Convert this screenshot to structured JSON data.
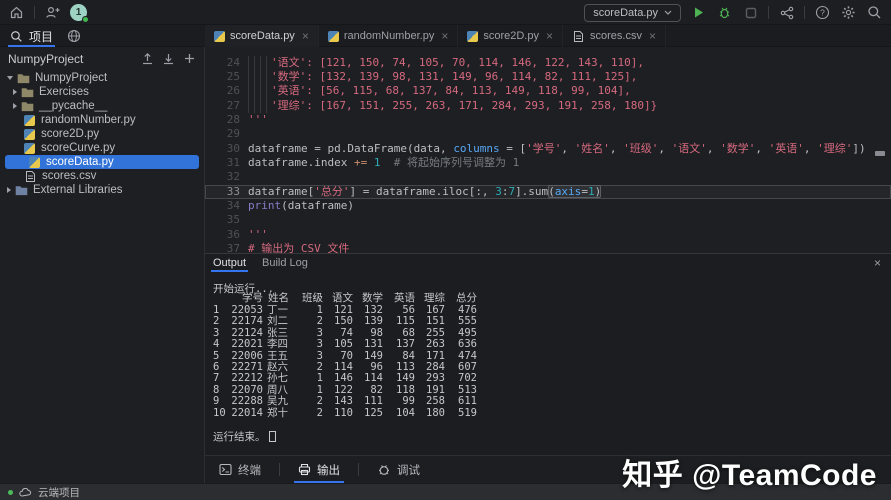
{
  "topbar": {
    "user_badge": "1",
    "run_config": "scoreData.py"
  },
  "sidebar": {
    "panel_tab_label": "项目",
    "header": "NumpyProject",
    "tree": [
      {
        "label": "NumpyProject",
        "icon": "folder",
        "chevron": "down",
        "depth": 0
      },
      {
        "label": "Exercises",
        "icon": "folder",
        "chevron": "right",
        "depth": 1
      },
      {
        "label": "__pycache__",
        "icon": "folder",
        "chevron": "right",
        "depth": 1
      },
      {
        "label": "randomNumber.py",
        "icon": "python",
        "depth": 1
      },
      {
        "label": "score2D.py",
        "icon": "python",
        "depth": 1
      },
      {
        "label": "scoreCurve.py",
        "icon": "python",
        "depth": 1
      },
      {
        "label": "scoreData.py",
        "icon": "python",
        "depth": 1,
        "selected": true
      },
      {
        "label": "scores.csv",
        "icon": "file",
        "depth": 1
      },
      {
        "label": "External Libraries",
        "icon": "lib",
        "chevron": "right",
        "depth": 0
      }
    ]
  },
  "editor_tabs": [
    {
      "label": "scoreData.py",
      "icon": "python",
      "active": true
    },
    {
      "label": "randomNumber.py",
      "icon": "python",
      "active": false
    },
    {
      "label": "score2D.py",
      "icon": "python",
      "active": false
    },
    {
      "label": "scores.csv",
      "icon": "file",
      "active": false
    }
  ],
  "editor": {
    "lines": [
      {
        "n": 24,
        "ind": true,
        "seg": [
          {
            "c": "s",
            "t": "'语文': [121, 150, 74, 105, 70, 114, 146, 122, 143, 110],"
          }
        ]
      },
      {
        "n": 25,
        "ind": true,
        "seg": [
          {
            "c": "s",
            "t": "'数学': [132, 139, 98, 131, 149, 96, 114, 82, 111, 125],"
          }
        ]
      },
      {
        "n": 26,
        "ind": true,
        "seg": [
          {
            "c": "s",
            "t": "'英语': [56, 115, 68, 137, 84, 113, 149, 118, 99, 104],"
          }
        ]
      },
      {
        "n": 27,
        "ind": true,
        "seg": [
          {
            "c": "s",
            "t": "'理综': [167, 151, 255, 263, 171, 284, 293, 191, 258, 180]}"
          }
        ]
      },
      {
        "n": 28,
        "seg": [
          {
            "c": "s",
            "t": "'''"
          }
        ]
      },
      {
        "n": 29,
        "seg": []
      },
      {
        "n": 30,
        "seg": [
          {
            "c": "d",
            "t": "dataframe = pd.DataFrame(data, "
          },
          {
            "c": "k",
            "t": "columns"
          },
          {
            "c": "d",
            "t": " = ["
          },
          {
            "c": "s",
            "t": "'学号'"
          },
          {
            "c": "d",
            "t": ", "
          },
          {
            "c": "s",
            "t": "'姓名'"
          },
          {
            "c": "d",
            "t": ", "
          },
          {
            "c": "s",
            "t": "'班级'"
          },
          {
            "c": "d",
            "t": ", "
          },
          {
            "c": "s",
            "t": "'语文'"
          },
          {
            "c": "d",
            "t": ", "
          },
          {
            "c": "s",
            "t": "'数学'"
          },
          {
            "c": "d",
            "t": ", "
          },
          {
            "c": "s",
            "t": "'英语'"
          },
          {
            "c": "d",
            "t": ", "
          },
          {
            "c": "s",
            "t": "'理综'"
          },
          {
            "c": "d",
            "t": "])"
          }
        ]
      },
      {
        "n": 31,
        "seg": [
          {
            "c": "d",
            "t": "dataframe.index "
          },
          {
            "c": "o",
            "t": "+="
          },
          {
            "c": "d",
            "t": " "
          },
          {
            "c": "num",
            "t": "1"
          },
          {
            "c": "c",
            "t": "  # 将起始序列号调整为 1"
          }
        ]
      },
      {
        "n": 32,
        "seg": []
      },
      {
        "n": 33,
        "cur": true,
        "seg": [
          {
            "c": "d",
            "t": "dataframe["
          },
          {
            "c": "s",
            "t": "'总分'"
          },
          {
            "c": "d",
            "t": "] = dataframe.iloc[:, "
          },
          {
            "c": "num",
            "t": "3"
          },
          {
            "c": "d",
            "t": ":"
          },
          {
            "c": "num",
            "t": "7"
          },
          {
            "c": "d",
            "t": "].sum"
          },
          {
            "c": "bx",
            "sub": [
              {
                "c": "d",
                "t": "("
              },
              {
                "c": "k",
                "t": "axis"
              },
              {
                "c": "d",
                "t": "="
              },
              {
                "c": "num",
                "t": "1"
              },
              {
                "c": "d",
                "t": ")"
              }
            ]
          }
        ]
      },
      {
        "n": 34,
        "seg": [
          {
            "c": "b",
            "t": "print"
          },
          {
            "c": "d",
            "t": "(dataframe)"
          }
        ]
      },
      {
        "n": 35,
        "seg": []
      },
      {
        "n": 36,
        "seg": [
          {
            "c": "s",
            "t": "'''"
          }
        ]
      },
      {
        "n": 37,
        "seg": [
          {
            "c": "s",
            "t": "# 输出为 CSV 文件"
          }
        ]
      }
    ]
  },
  "output": {
    "tabs": [
      {
        "label": "Output",
        "active": true
      },
      {
        "label": "Build Log",
        "active": false
      }
    ],
    "start_line": "开始运行...",
    "end_line": "运行结束。",
    "table": {
      "headers": [
        "学号",
        "姓名",
        "班级",
        "语文",
        "数学",
        "英语",
        "理综",
        "总分"
      ],
      "rows": [
        [
          1,
          22053,
          "丁一",
          1,
          121,
          132,
          56,
          167,
          476
        ],
        [
          2,
          22174,
          "刘二",
          2,
          150,
          139,
          115,
          151,
          555
        ],
        [
          3,
          22124,
          "张三",
          3,
          74,
          98,
          68,
          255,
          495
        ],
        [
          4,
          22021,
          "李四",
          3,
          105,
          131,
          137,
          263,
          636
        ],
        [
          5,
          22006,
          "王五",
          3,
          70,
          149,
          84,
          171,
          474
        ],
        [
          6,
          22271,
          "赵六",
          2,
          114,
          96,
          113,
          284,
          607
        ],
        [
          7,
          22212,
          "孙七",
          1,
          146,
          114,
          149,
          293,
          702
        ],
        [
          8,
          22070,
          "周八",
          1,
          122,
          82,
          118,
          191,
          513
        ],
        [
          9,
          22288,
          "吴九",
          2,
          143,
          111,
          99,
          258,
          611
        ],
        [
          10,
          22014,
          "郑十",
          2,
          110,
          125,
          104,
          180,
          519
        ]
      ]
    }
  },
  "tool_bar": {
    "items": [
      {
        "label": "终端",
        "icon": "terminal-icon",
        "active": false
      },
      {
        "label": "输出",
        "icon": "printer-icon",
        "active": true
      },
      {
        "label": "调试",
        "icon": "debug-icon",
        "active": false
      }
    ]
  },
  "status_bar": {
    "left_label": "云端项目"
  },
  "watermark": "知乎 @TeamCode",
  "colors": {
    "accent_blue": "#3574f0",
    "selection_blue": "#3273d9",
    "run_green": "#4db353",
    "string_pink": "#d5697f",
    "number_teal": "#2aacb8",
    "keyword_blue": "#56a8f5",
    "operator_orange": "#cf8e6d",
    "builtin_purple": "#8a7bc8",
    "editor_bg": "#1e1f22"
  }
}
